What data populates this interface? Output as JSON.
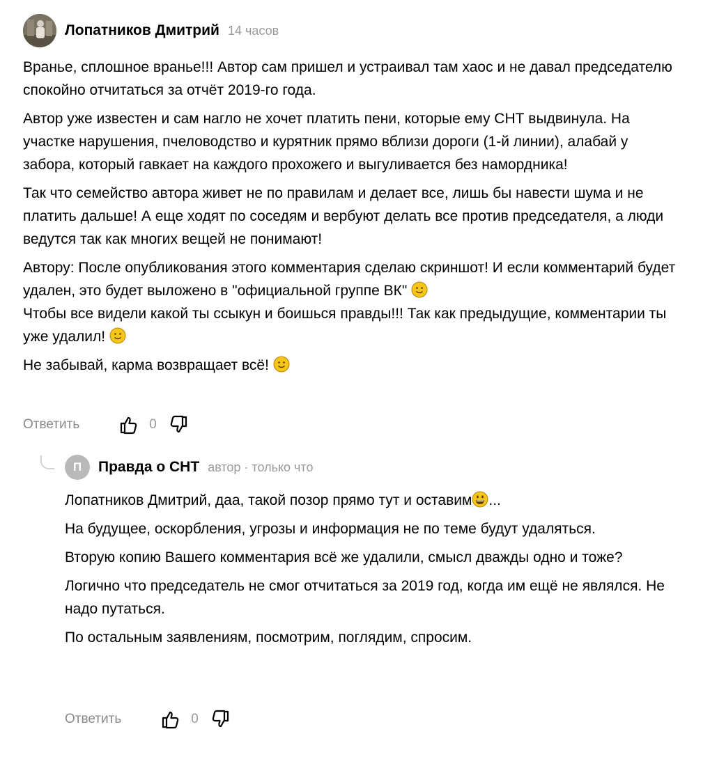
{
  "comments": [
    {
      "author": "Лопатников Дмитрий",
      "meta": "14 часов",
      "paragraphs": [
        "Вранье, сплошное вранье!!! Автор сам пришел и устраивал там хаос и не давал председателю спокойно отчитаться за отчёт 2019-го года.",
        "Автор уже известен и сам нагло не хочет платить пени, которые ему СНТ выдвинула. На участке нарушения, пчеловодство и курятник прямо вблизи дороги (1-й линии), алабай у забора, который гавкает на каждого прохожего и выгуливается без намордника!",
        "Так что семейство автора живет не по правилам и делает все, лишь бы навести шума и не платить дальше! А еще ходят по соседям и вербуют делать все против председателя, а люди ведутся так как многих вещей не понимают!",
        "Автору: После опубликования этого комментария сделаю скриншот! И если комментарий будет удален, это будет выложено в \"официальной группе ВК\"",
        "Чтобы все видели какой ты ссыкун и боишься правды!!! Так как предыдущие, комментарии ты уже удалил!",
        "Не забывай, карма возвращает всё!"
      ],
      "reply_label": "Ответить",
      "likes": "0"
    },
    {
      "author": "Правда о СНТ",
      "avatar_letter": "П",
      "meta": "автор · только что",
      "paragraphs": [
        "Лопатников Дмитрий, даа, такой позор прямо тут и оставим",
        "...",
        "На будущее, оскорбления, угрозы и информация не по теме будут удаляться.",
        "Вторую копию Вашего комментария всё же удалили, смысл дважды одно и тоже?",
        "Логично что председатель не смог отчитаться за 2019 год, когда им ещё не являлся. Не надо путаться.",
        "По остальным заявлениям, посмотрим, поглядим, спросим."
      ],
      "reply_label": "Ответить",
      "likes": "0"
    }
  ],
  "icons": {
    "like": "thumb-up-icon",
    "dislike": "thumb-down-icon",
    "smile": "slightly-smiling-emoji",
    "grin": "grinning-emoji"
  },
  "colors": {
    "meta": "#9a9a9a",
    "reply": "#8a8a8a",
    "emoji": "#f5c518"
  }
}
